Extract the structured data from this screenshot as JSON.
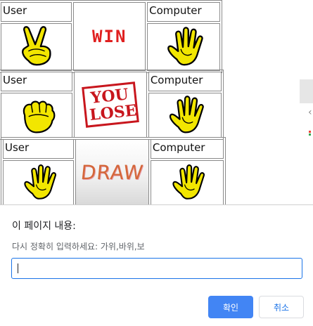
{
  "rounds": [
    {
      "user_label": "User",
      "computer_label": "Computer",
      "user_hand": "victory-hand-icon",
      "computer_hand": "open-hand-icon",
      "result_text": "WIN"
    },
    {
      "user_label": "User",
      "computer_label": "Computer",
      "user_hand": "fist-hand-icon",
      "computer_hand": "open-hand-icon",
      "result_text": "YOU LOSE"
    },
    {
      "user_label": "User",
      "computer_label": "Computer",
      "user_hand": "open-hand-icon",
      "computer_hand": "open-hand-icon",
      "result_text": "DRAW"
    }
  ],
  "dialog": {
    "title": "이 페이지 내용:",
    "message": "다시 정확히 입력하세요: 가위,바위,보",
    "input_value": "",
    "ok_label": "확인",
    "cancel_label": "취소"
  },
  "colors": {
    "hand_fill": "#f2e600",
    "win_red": "#e02020",
    "lose_red": "#c8161d",
    "dialog_accent": "#4285f4"
  }
}
